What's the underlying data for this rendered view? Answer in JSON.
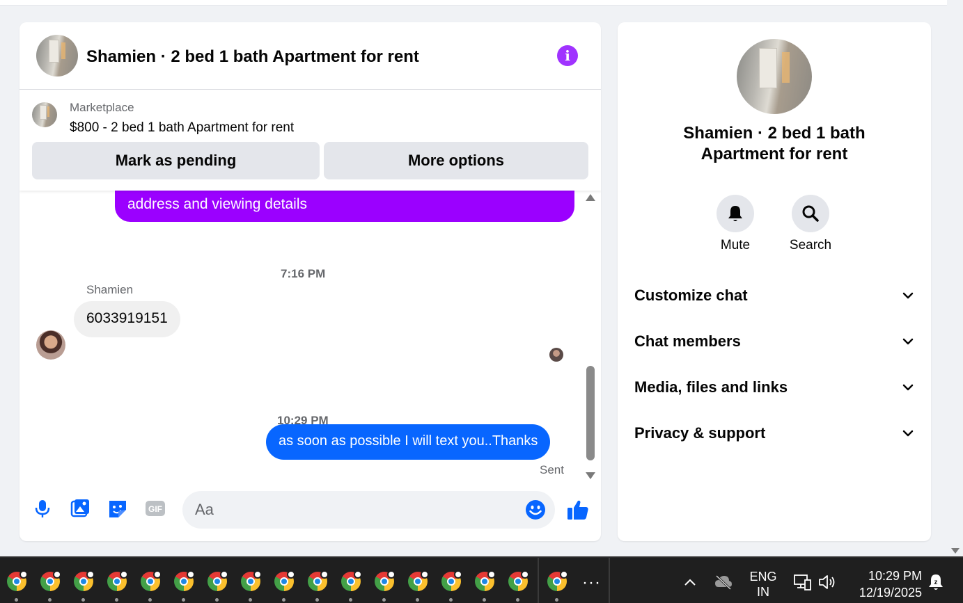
{
  "chat": {
    "title": "Shamien · 2 bed 1 bath Apartment for rent",
    "marketplace_label": "Marketplace",
    "listing": "$800 - 2 bed 1 bath Apartment for rent",
    "mark_pending_label": "Mark as pending",
    "more_options_label": "More options"
  },
  "messages": {
    "outgoing_1": "address and viewing details",
    "time_1": "7:16 PM",
    "sender": "Shamien",
    "incoming_1": "6033919151",
    "time_2": "10:29 PM",
    "outgoing_2": "as soon as possible I will text you..Thanks",
    "status": "Sent"
  },
  "composer": {
    "placeholder": "Aa",
    "icons": [
      "microphone-icon",
      "photo-icon",
      "sticker-icon",
      "gif-icon",
      "emoji-icon",
      "thumbs-up-icon"
    ]
  },
  "panel": {
    "title_line1": "Shamien · 2 bed 1 bath",
    "title_line2": "Apartment for rent",
    "mute_label": "Mute",
    "search_label": "Search",
    "sections": [
      "Customize chat",
      "Chat members",
      "Media, files and links",
      "Privacy & support"
    ]
  },
  "taskbar": {
    "language_line1": "ENG",
    "language_line2": "IN",
    "time": "10:29 PM",
    "date": "12/19/2025",
    "more_glyph": "···"
  },
  "colors": {
    "outgoing_purple": "#9b00ff",
    "outgoing_blue": "#0866ff",
    "accent_info": "#a033ff",
    "composer_icons": "#0866ff"
  }
}
